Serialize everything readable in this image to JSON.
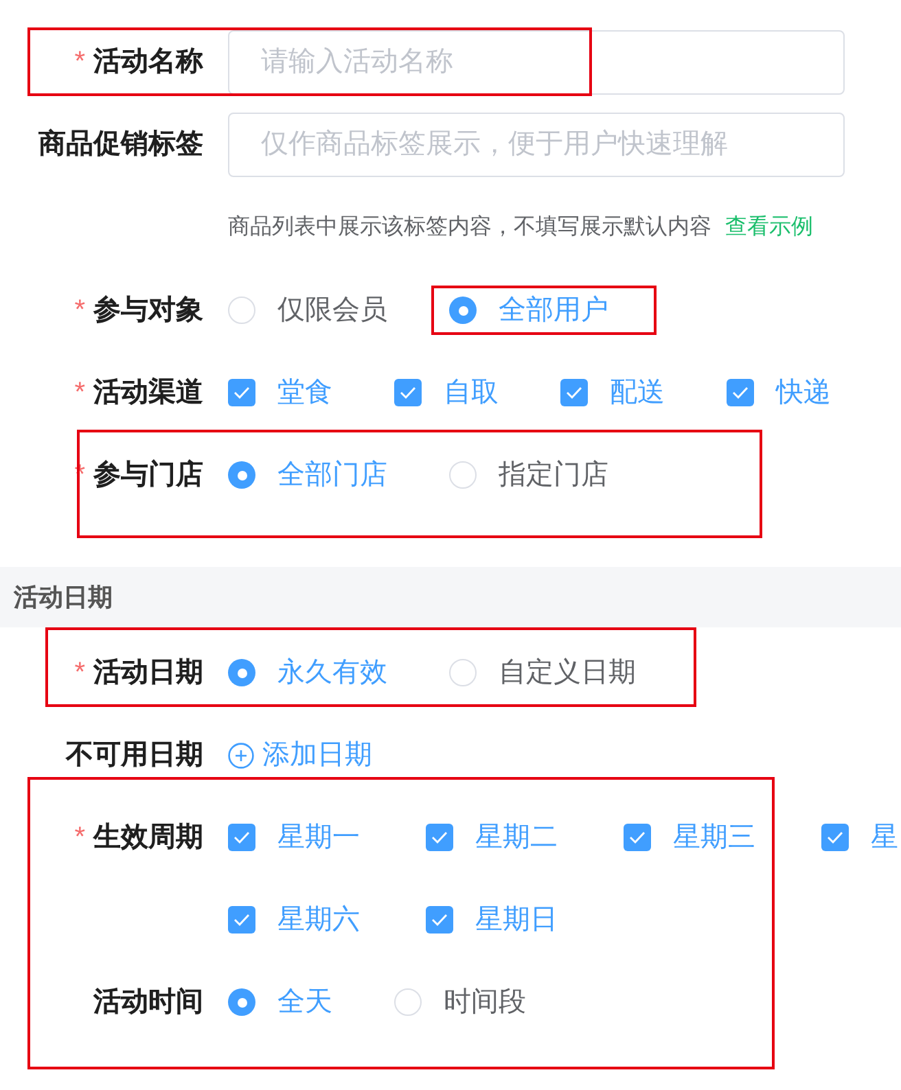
{
  "form_top": [
    {
      "kind": "text_input",
      "label": "活动名称",
      "required_mark": "*",
      "placeholder": "请输入活动名称",
      "framed": true
    },
    {
      "kind": "text_input",
      "label": "商品促销标签",
      "placeholder": "仅作商品标签展示，便于用户快速理解",
      "framed": false
    },
    {
      "kind": "hint",
      "text": "商品列表中展示该标签内容，不填写展示默认内容",
      "link": "查看示例"
    },
    {
      "kind": "radio",
      "label": "参与对象",
      "required_mark": "*",
      "framed": false,
      "options": [
        {
          "label": "仅限会员",
          "selected": false,
          "framed": false
        },
        {
          "label": "全部用户",
          "selected": true,
          "framed": true
        }
      ]
    },
    {
      "kind": "checkbox",
      "label": "活动渠道",
      "required_mark": "*",
      "framed": false,
      "options": [
        {
          "label": "堂食",
          "checked": true
        },
        {
          "label": "自取",
          "checked": true
        },
        {
          "label": "配送",
          "checked": true
        },
        {
          "label": "快递",
          "checked": true
        }
      ]
    },
    {
      "kind": "radio",
      "label": "参与门店",
      "required_mark": "*",
      "framed": true,
      "options": [
        {
          "label": "全部门店",
          "selected": true,
          "framed": false
        },
        {
          "label": "指定门店",
          "selected": false,
          "framed": false
        }
      ]
    }
  ],
  "section_title": "活动日期",
  "form_bottom": [
    {
      "kind": "radio",
      "label": "活动日期",
      "required_mark": "*",
      "framed": true,
      "options": [
        {
          "label": "永久有效",
          "selected": true,
          "framed": false
        },
        {
          "label": "自定义日期",
          "selected": false,
          "framed": false
        }
      ]
    },
    {
      "kind": "add_link",
      "label": "不可用日期",
      "link": "添加日期"
    },
    {
      "kind": "weekdays",
      "label": "生效周期",
      "required_mark": "*",
      "framed": true,
      "options": [
        {
          "label": "星期一",
          "checked": true
        },
        {
          "label": "星期二",
          "checked": true
        },
        {
          "label": "星期三",
          "checked": true
        },
        {
          "label": "星",
          "checked": true
        },
        {
          "label": "星期六",
          "checked": true
        },
        {
          "label": "星期日",
          "checked": true
        }
      ]
    },
    {
      "kind": "radio",
      "label": "活动时间",
      "framed": false,
      "options": [
        {
          "label": "全天",
          "selected": true,
          "framed": false
        },
        {
          "label": "时间段",
          "selected": false,
          "framed": false
        }
      ]
    }
  ]
}
